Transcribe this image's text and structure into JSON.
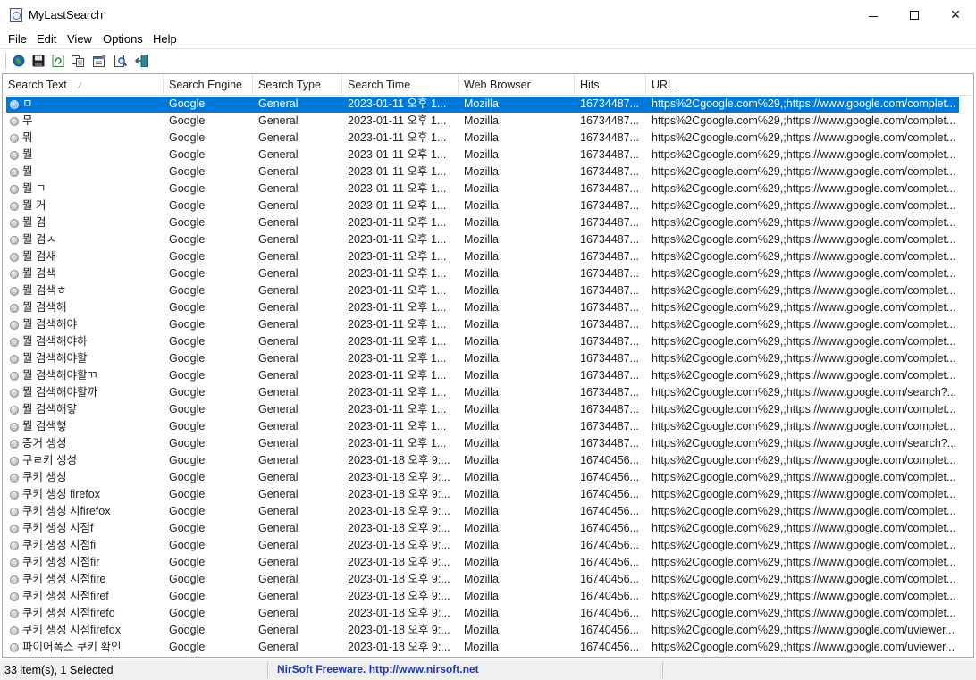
{
  "window": {
    "title": "MyLastSearch"
  },
  "menu": [
    "File",
    "Edit",
    "View",
    "Options",
    "Help"
  ],
  "toolbar": {
    "icons": [
      "html-report-icon",
      "save-icon",
      "refresh-icon",
      "copy-icon",
      "properties-icon",
      "find-icon",
      "exit-icon"
    ]
  },
  "columns": {
    "search_text": "Search Text",
    "search_engine": "Search Engine",
    "search_type": "Search Type",
    "search_time": "Search Time",
    "web_browser": "Web Browser",
    "hits": "Hits",
    "url": "URL"
  },
  "rows": [
    {
      "text": "ㅁ",
      "engine": "Google",
      "type": "General",
      "time": "2023-01-11 오후 1...",
      "browser": "Mozilla",
      "hits": "16734487...",
      "url": "https%2Cgoogle.com%29,;https://www.google.com/complet..."
    },
    {
      "text": "무",
      "engine": "Google",
      "type": "General",
      "time": "2023-01-11 오후 1...",
      "browser": "Mozilla",
      "hits": "16734487...",
      "url": "https%2Cgoogle.com%29,;https://www.google.com/complet..."
    },
    {
      "text": "뭐",
      "engine": "Google",
      "type": "General",
      "time": "2023-01-11 오후 1...",
      "browser": "Mozilla",
      "hits": "16734487...",
      "url": "https%2Cgoogle.com%29,;https://www.google.com/complet..."
    },
    {
      "text": "뭘",
      "engine": "Google",
      "type": "General",
      "time": "2023-01-11 오후 1...",
      "browser": "Mozilla",
      "hits": "16734487...",
      "url": "https%2Cgoogle.com%29,;https://www.google.com/complet..."
    },
    {
      "text": "뭘",
      "engine": "Google",
      "type": "General",
      "time": "2023-01-11 오후 1...",
      "browser": "Mozilla",
      "hits": "16734487...",
      "url": "https%2Cgoogle.com%29,;https://www.google.com/complet..."
    },
    {
      "text": "뭘 ㄱ",
      "engine": "Google",
      "type": "General",
      "time": "2023-01-11 오후 1...",
      "browser": "Mozilla",
      "hits": "16734487...",
      "url": "https%2Cgoogle.com%29,;https://www.google.com/complet..."
    },
    {
      "text": "뭘 거",
      "engine": "Google",
      "type": "General",
      "time": "2023-01-11 오후 1...",
      "browser": "Mozilla",
      "hits": "16734487...",
      "url": "https%2Cgoogle.com%29,;https://www.google.com/complet..."
    },
    {
      "text": "뭘 검",
      "engine": "Google",
      "type": "General",
      "time": "2023-01-11 오후 1...",
      "browser": "Mozilla",
      "hits": "16734487...",
      "url": "https%2Cgoogle.com%29,;https://www.google.com/complet..."
    },
    {
      "text": "뭘 검ㅅ",
      "engine": "Google",
      "type": "General",
      "time": "2023-01-11 오후 1...",
      "browser": "Mozilla",
      "hits": "16734487...",
      "url": "https%2Cgoogle.com%29,;https://www.google.com/complet..."
    },
    {
      "text": "뭘 검새",
      "engine": "Google",
      "type": "General",
      "time": "2023-01-11 오후 1...",
      "browser": "Mozilla",
      "hits": "16734487...",
      "url": "https%2Cgoogle.com%29,;https://www.google.com/complet..."
    },
    {
      "text": "뭘 검색",
      "engine": "Google",
      "type": "General",
      "time": "2023-01-11 오후 1...",
      "browser": "Mozilla",
      "hits": "16734487...",
      "url": "https%2Cgoogle.com%29,;https://www.google.com/complet..."
    },
    {
      "text": "뭘 검색ㅎ",
      "engine": "Google",
      "type": "General",
      "time": "2023-01-11 오후 1...",
      "browser": "Mozilla",
      "hits": "16734487...",
      "url": "https%2Cgoogle.com%29,;https://www.google.com/complet..."
    },
    {
      "text": "뭘 검색해",
      "engine": "Google",
      "type": "General",
      "time": "2023-01-11 오후 1...",
      "browser": "Mozilla",
      "hits": "16734487...",
      "url": "https%2Cgoogle.com%29,;https://www.google.com/complet..."
    },
    {
      "text": "뭘 검색해야",
      "engine": "Google",
      "type": "General",
      "time": "2023-01-11 오후 1...",
      "browser": "Mozilla",
      "hits": "16734487...",
      "url": "https%2Cgoogle.com%29,;https://www.google.com/complet..."
    },
    {
      "text": "뭘 검색해야하",
      "engine": "Google",
      "type": "General",
      "time": "2023-01-11 오후 1...",
      "browser": "Mozilla",
      "hits": "16734487...",
      "url": "https%2Cgoogle.com%29,;https://www.google.com/complet..."
    },
    {
      "text": "뭘 검색해야할",
      "engine": "Google",
      "type": "General",
      "time": "2023-01-11 오후 1...",
      "browser": "Mozilla",
      "hits": "16734487...",
      "url": "https%2Cgoogle.com%29,;https://www.google.com/complet..."
    },
    {
      "text": "뭘 검색해야할ㄲ",
      "engine": "Google",
      "type": "General",
      "time": "2023-01-11 오후 1...",
      "browser": "Mozilla",
      "hits": "16734487...",
      "url": "https%2Cgoogle.com%29,;https://www.google.com/complet..."
    },
    {
      "text": "뭘 검색해야할까",
      "engine": "Google",
      "type": "General",
      "time": "2023-01-11 오후 1...",
      "browser": "Mozilla",
      "hits": "16734487...",
      "url": "https%2Cgoogle.com%29,;https://www.google.com/search?..."
    },
    {
      "text": "뭘 검색해얗",
      "engine": "Google",
      "type": "General",
      "time": "2023-01-11 오후 1...",
      "browser": "Mozilla",
      "hits": "16734487...",
      "url": "https%2Cgoogle.com%29,;https://www.google.com/complet..."
    },
    {
      "text": "뭘 검색햏",
      "engine": "Google",
      "type": "General",
      "time": "2023-01-11 오후 1...",
      "browser": "Mozilla",
      "hits": "16734487...",
      "url": "https%2Cgoogle.com%29,;https://www.google.com/complet..."
    },
    {
      "text": "증거 생성",
      "engine": "Google",
      "type": "General",
      "time": "2023-01-11 오후 1...",
      "browser": "Mozilla",
      "hits": "16734487...",
      "url": "https%2Cgoogle.com%29,;https://www.google.com/search?..."
    },
    {
      "text": "쿠ㄹ키 생성",
      "engine": "Google",
      "type": "General",
      "time": "2023-01-18 오후 9:...",
      "browser": "Mozilla",
      "hits": "16740456...",
      "url": "https%2Cgoogle.com%29,;https://www.google.com/complet..."
    },
    {
      "text": "쿠키 생성",
      "engine": "Google",
      "type": "General",
      "time": "2023-01-18 오후 9:...",
      "browser": "Mozilla",
      "hits": "16740456...",
      "url": "https%2Cgoogle.com%29,;https://www.google.com/complet..."
    },
    {
      "text": "쿠키 생성 firefox",
      "engine": "Google",
      "type": "General",
      "time": "2023-01-18 오후 9:...",
      "browser": "Mozilla",
      "hits": "16740456...",
      "url": "https%2Cgoogle.com%29,;https://www.google.com/complet..."
    },
    {
      "text": "쿠키 생성 시firefox",
      "engine": "Google",
      "type": "General",
      "time": "2023-01-18 오후 9:...",
      "browser": "Mozilla",
      "hits": "16740456...",
      "url": "https%2Cgoogle.com%29,;https://www.google.com/complet..."
    },
    {
      "text": "쿠키 생성 시점f",
      "engine": "Google",
      "type": "General",
      "time": "2023-01-18 오후 9:...",
      "browser": "Mozilla",
      "hits": "16740456...",
      "url": "https%2Cgoogle.com%29,;https://www.google.com/complet..."
    },
    {
      "text": "쿠키 생성 시점fi",
      "engine": "Google",
      "type": "General",
      "time": "2023-01-18 오후 9:...",
      "browser": "Mozilla",
      "hits": "16740456...",
      "url": "https%2Cgoogle.com%29,;https://www.google.com/complet..."
    },
    {
      "text": "쿠키 생성 시점fir",
      "engine": "Google",
      "type": "General",
      "time": "2023-01-18 오후 9:...",
      "browser": "Mozilla",
      "hits": "16740456...",
      "url": "https%2Cgoogle.com%29,;https://www.google.com/complet..."
    },
    {
      "text": "쿠키 생성 시점fire",
      "engine": "Google",
      "type": "General",
      "time": "2023-01-18 오후 9:...",
      "browser": "Mozilla",
      "hits": "16740456...",
      "url": "https%2Cgoogle.com%29,;https://www.google.com/complet..."
    },
    {
      "text": "쿠키 생성 시점firef",
      "engine": "Google",
      "type": "General",
      "time": "2023-01-18 오후 9:...",
      "browser": "Mozilla",
      "hits": "16740456...",
      "url": "https%2Cgoogle.com%29,;https://www.google.com/complet..."
    },
    {
      "text": "쿠키 생성 시점firefo",
      "engine": "Google",
      "type": "General",
      "time": "2023-01-18 오후 9:...",
      "browser": "Mozilla",
      "hits": "16740456...",
      "url": "https%2Cgoogle.com%29,;https://www.google.com/complet..."
    },
    {
      "text": "쿠키 생성 시점firefox",
      "engine": "Google",
      "type": "General",
      "time": "2023-01-18 오후 9:...",
      "browser": "Mozilla",
      "hits": "16740456...",
      "url": "https%2Cgoogle.com%29,;https://www.google.com/uviewer..."
    },
    {
      "text": "파이어폭스 쿠키 확인",
      "engine": "Google",
      "type": "General",
      "time": "2023-01-18 오후 9:...",
      "browser": "Mozilla",
      "hits": "16740456...",
      "url": "https%2Cgoogle.com%29,;https://www.google.com/uviewer..."
    }
  ],
  "selected_index": 0,
  "status": {
    "count": "33 item(s), 1 Selected",
    "link": "NirSoft Freeware.  http://www.nirsoft.net"
  },
  "colors": {
    "selection": "#0078d7",
    "status_link": "#1a33c7"
  }
}
